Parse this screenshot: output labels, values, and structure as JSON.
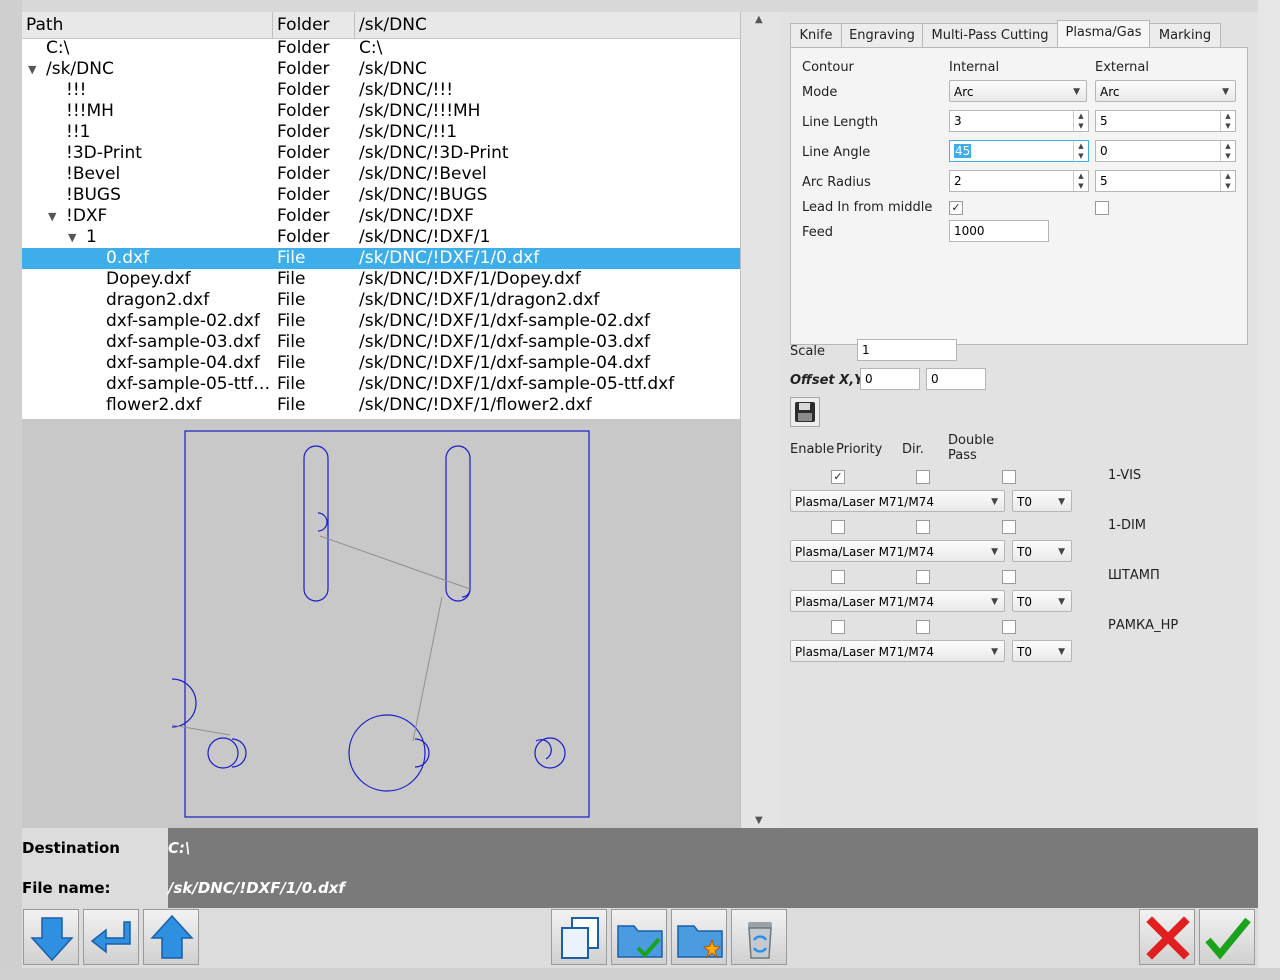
{
  "tree": {
    "headers": {
      "path": "Path",
      "type": "Folder",
      "full": "/sk/DNC"
    },
    "rows": [
      {
        "name": "C:\\",
        "type": "Folder",
        "full": "C:\\"
      },
      {
        "name": "/sk/DNC",
        "type": "Folder",
        "full": "/sk/DNC"
      },
      {
        "name": "!!!",
        "type": "Folder",
        "full": "/sk/DNC/!!!"
      },
      {
        "name": "!!!MH",
        "type": "Folder",
        "full": "/sk/DNC/!!!MH"
      },
      {
        "name": "!!1",
        "type": "Folder",
        "full": "/sk/DNC/!!1"
      },
      {
        "name": "!3D-Print",
        "type": "Folder",
        "full": "/sk/DNC/!3D-Print"
      },
      {
        "name": "!Bevel",
        "type": "Folder",
        "full": "/sk/DNC/!Bevel"
      },
      {
        "name": "!BUGS",
        "type": "Folder",
        "full": "/sk/DNC/!BUGS"
      },
      {
        "name": "!DXF",
        "type": "Folder",
        "full": "/sk/DNC/!DXF"
      },
      {
        "name": "1",
        "type": "Folder",
        "full": "/sk/DNC/!DXF/1"
      },
      {
        "name": "0.dxf",
        "type": "File",
        "full": "/sk/DNC/!DXF/1/0.dxf"
      },
      {
        "name": "Dopey.dxf",
        "type": "File",
        "full": "/sk/DNC/!DXF/1/Dopey.dxf"
      },
      {
        "name": "dragon2.dxf",
        "type": "File",
        "full": "/sk/DNC/!DXF/1/dragon2.dxf"
      },
      {
        "name": "dxf-sample-02.dxf",
        "type": "File",
        "full": "/sk/DNC/!DXF/1/dxf-sample-02.dxf"
      },
      {
        "name": "dxf-sample-03.dxf",
        "type": "File",
        "full": "/sk/DNC/!DXF/1/dxf-sample-03.dxf"
      },
      {
        "name": "dxf-sample-04.dxf",
        "type": "File",
        "full": "/sk/DNC/!DXF/1/dxf-sample-04.dxf"
      },
      {
        "name": "dxf-sample-05-ttf…",
        "type": "File",
        "full": "/sk/DNC/!DXF/1/dxf-sample-05-ttf.dxf"
      },
      {
        "name": "flower2.dxf",
        "type": "File",
        "full": "/sk/DNC/!DXF/1/flower2.dxf"
      }
    ]
  },
  "tabs": [
    "Knife",
    "Engraving",
    "Multi-Pass Cutting",
    "Plasma/Gas",
    "Marking"
  ],
  "plasma": {
    "contour": "Contour",
    "internal": "Internal",
    "external": "External",
    "mode_label": "Mode",
    "mode_internal": "Arc",
    "mode_external": "Arc",
    "line_length_label": "Line Length",
    "line_length_internal": "3",
    "line_length_external": "5",
    "line_angle_label": "Line Angle",
    "line_angle_internal": "45",
    "line_angle_external": "0",
    "arc_radius_label": "Arc Radius",
    "arc_radius_internal": "2",
    "arc_radius_external": "5",
    "lead_in_label": "Lead In from middle",
    "feed_label": "Feed",
    "feed_value": "1000"
  },
  "scale_label": "Scale",
  "scale_value": "1",
  "offset_label": "Offset X,Y",
  "offset_x": "0",
  "offset_y": "0",
  "layers_header": {
    "enable": "Enable",
    "priority": "Priority",
    "dir": "Dir.",
    "double_pass": "Double Pass"
  },
  "layers": [
    {
      "name": "1-VIS",
      "enabled": true,
      "tool": "Plasma/Laser M71/M74",
      "t": "T0"
    },
    {
      "name": "1-DIM",
      "enabled": false,
      "tool": "Plasma/Laser M71/M74",
      "t": "T0"
    },
    {
      "name": "ШТАМП",
      "enabled": false,
      "tool": "Plasma/Laser M71/M74",
      "t": "T0"
    },
    {
      "name": "РАМКА_HP",
      "enabled": false,
      "tool": "Plasma/Laser M71/M74",
      "t": "T0"
    }
  ],
  "destination_label": "Destination Folder:",
  "destination_value": "C:\\",
  "filename_label": "File name:",
  "filename_value": "/sk/DNC/!DXF/1/0.dxf",
  "colors": {
    "selection": "#3daee9",
    "preview_stroke": "#1c1cc8"
  },
  "icons": [
    "arrow-down-icon",
    "enter-icon",
    "arrow-up-icon",
    "copy-icon",
    "folder-check-icon",
    "folder-new-icon",
    "recycle-bin-icon",
    "cancel-icon",
    "ok-icon",
    "save-icon"
  ]
}
